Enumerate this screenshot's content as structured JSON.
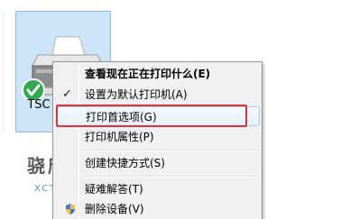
{
  "printer": {
    "name": "TSC"
  },
  "watermark": {
    "text": "骁唐智能",
    "subtext": "XCTANG"
  },
  "context_menu": {
    "items": [
      {
        "label": "查看现在正在打印什么(E)",
        "bold": true,
        "checked": false
      },
      {
        "label": "设置为默认打印机(A)",
        "bold": false,
        "checked": true
      },
      {
        "label": "打印首选项(G)",
        "bold": false,
        "checked": false,
        "hovered": true
      },
      {
        "label": "打印机属性(P)",
        "bold": false,
        "checked": false
      },
      {
        "label": "创建快捷方式(S)",
        "bold": false,
        "checked": false
      },
      {
        "label": "疑难解答(T)",
        "bold": false,
        "checked": false
      },
      {
        "label": "删除设备(V)",
        "bold": false,
        "checked": false,
        "shield": true
      }
    ],
    "check_glyph": "✓"
  },
  "colors": {
    "tile_selected": "#cce4f7",
    "highlight": "#d9343f",
    "menu_bg": "#f0f0f0"
  }
}
